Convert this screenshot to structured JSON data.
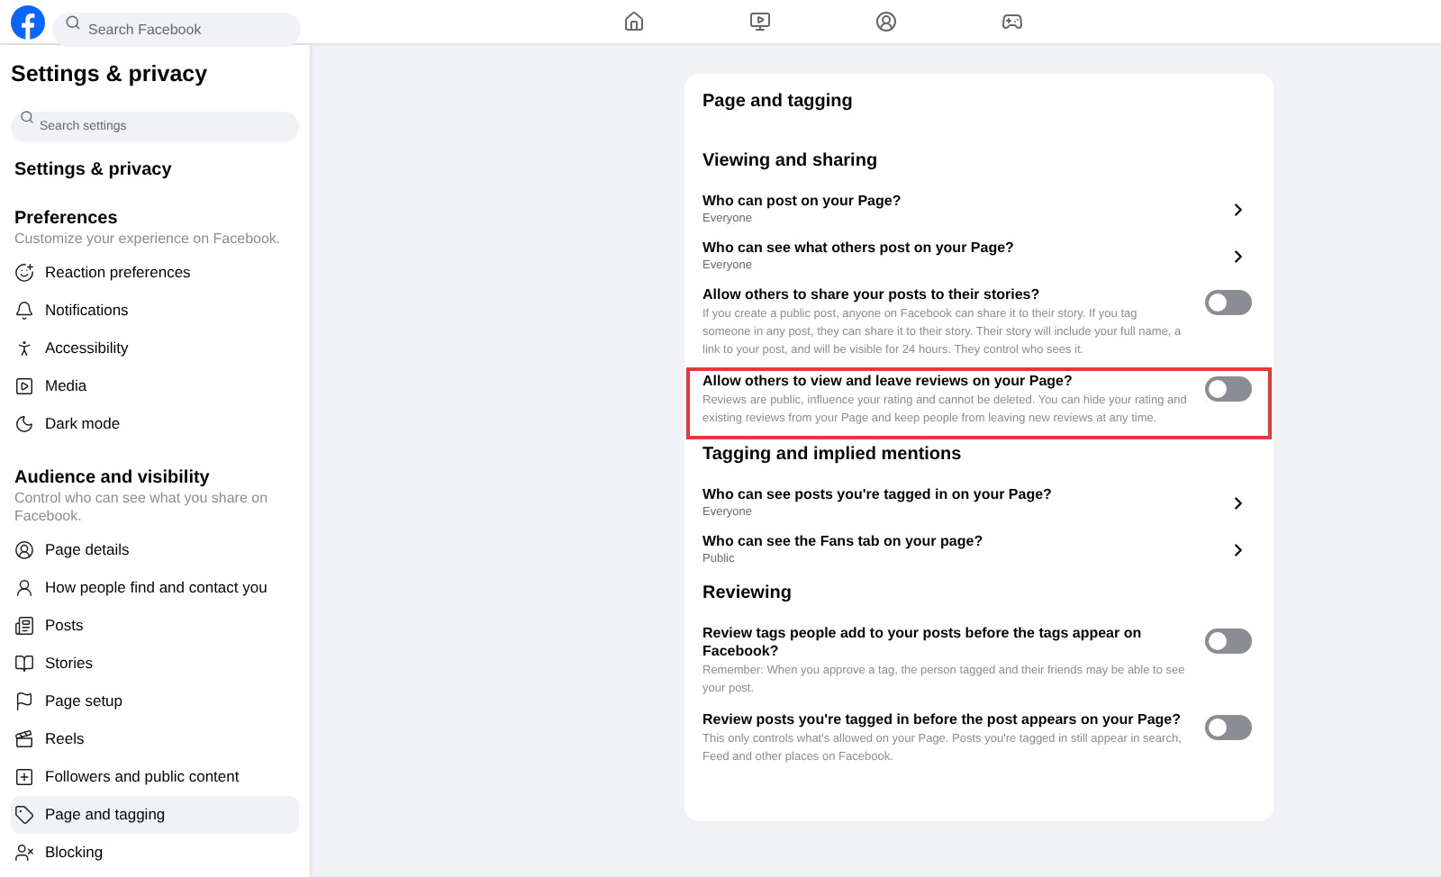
{
  "topbar": {
    "search": {
      "placeholder": "Search Facebook"
    },
    "nav": [
      {
        "kind": "home",
        "selected": false
      },
      {
        "kind": "video",
        "selected": false
      },
      {
        "kind": "profile",
        "selected": false
      },
      {
        "kind": "gaming",
        "selected": false
      }
    ]
  },
  "sidebar": {
    "title": "Settings & privacy",
    "search": {
      "placeholder": "Search settings"
    },
    "heading": "Settings & privacy",
    "groups": [
      {
        "title": "Preferences",
        "subtitle": "Customize your experience on Facebook.",
        "items": [
          {
            "label": "Reaction preferences",
            "selected": false
          },
          {
            "label": "Notifications",
            "selected": false
          },
          {
            "label": "Accessibility",
            "selected": false
          },
          {
            "label": "Media",
            "selected": false
          },
          {
            "label": "Dark mode",
            "selected": false
          }
        ]
      },
      {
        "title": "Audience and visibility",
        "subtitle": "Control who can see what you share on Facebook.",
        "items": [
          {
            "label": "Page details",
            "selected": false
          },
          {
            "label": "How people find and contact you",
            "selected": false
          },
          {
            "label": "Posts",
            "selected": false
          },
          {
            "label": "Stories",
            "selected": false
          },
          {
            "label": "Page setup",
            "selected": false
          },
          {
            "label": "Reels",
            "selected": false
          },
          {
            "label": "Followers and public content",
            "selected": false
          },
          {
            "label": "Page and tagging",
            "selected": true
          },
          {
            "label": "Blocking",
            "selected": false
          }
        ]
      }
    ]
  },
  "card": {
    "title": "Page and tagging",
    "sections": [
      {
        "heading": "Viewing and sharing",
        "rows": [
          {
            "kind": "link",
            "title": "Who can post on your Page?",
            "value": "Everyone",
            "highlighted": false
          },
          {
            "kind": "link",
            "title": "Who can see what others post on your Page?",
            "value": "Everyone",
            "highlighted": false
          },
          {
            "kind": "toggle",
            "title": "Allow others to share your posts to their stories?",
            "description": "If you create a public post, anyone on Facebook can share it to their story. If you tag someone in any post, they can share it to their story. Their story will include your full name, a link to your post, and will be visible for 24 hours. They control who sees it.",
            "on": false,
            "highlighted": false
          },
          {
            "kind": "toggle",
            "title": "Allow others to view and leave reviews on your Page?",
            "description": "Reviews are public, influence your rating and cannot be deleted. You can hide your rating and existing reviews from your Page and keep people from leaving new reviews at any time.",
            "on": false,
            "highlighted": true
          }
        ]
      },
      {
        "heading": "Tagging and implied mentions",
        "rows": [
          {
            "kind": "link",
            "title": "Who can see posts you're tagged in on your Page?",
            "value": "Everyone",
            "highlighted": false
          },
          {
            "kind": "link",
            "title": "Who can see the Fans tab on your page?",
            "value": "Public",
            "highlighted": false
          }
        ]
      },
      {
        "heading": "Reviewing",
        "rows": [
          {
            "kind": "toggle",
            "title": "Review tags people add to your posts before the tags appear on Facebook?",
            "description": "Remember: When you approve a tag, the person tagged and their friends may be able to see your post.",
            "on": false,
            "highlighted": false
          },
          {
            "kind": "toggle",
            "title": "Review posts you're tagged in before the post appears on your Page?",
            "description": "This only controls what's allowed on your Page. Posts you're tagged in still appear in search, Feed and other places on Facebook.",
            "on": false,
            "highlighted": false
          }
        ]
      }
    ]
  }
}
